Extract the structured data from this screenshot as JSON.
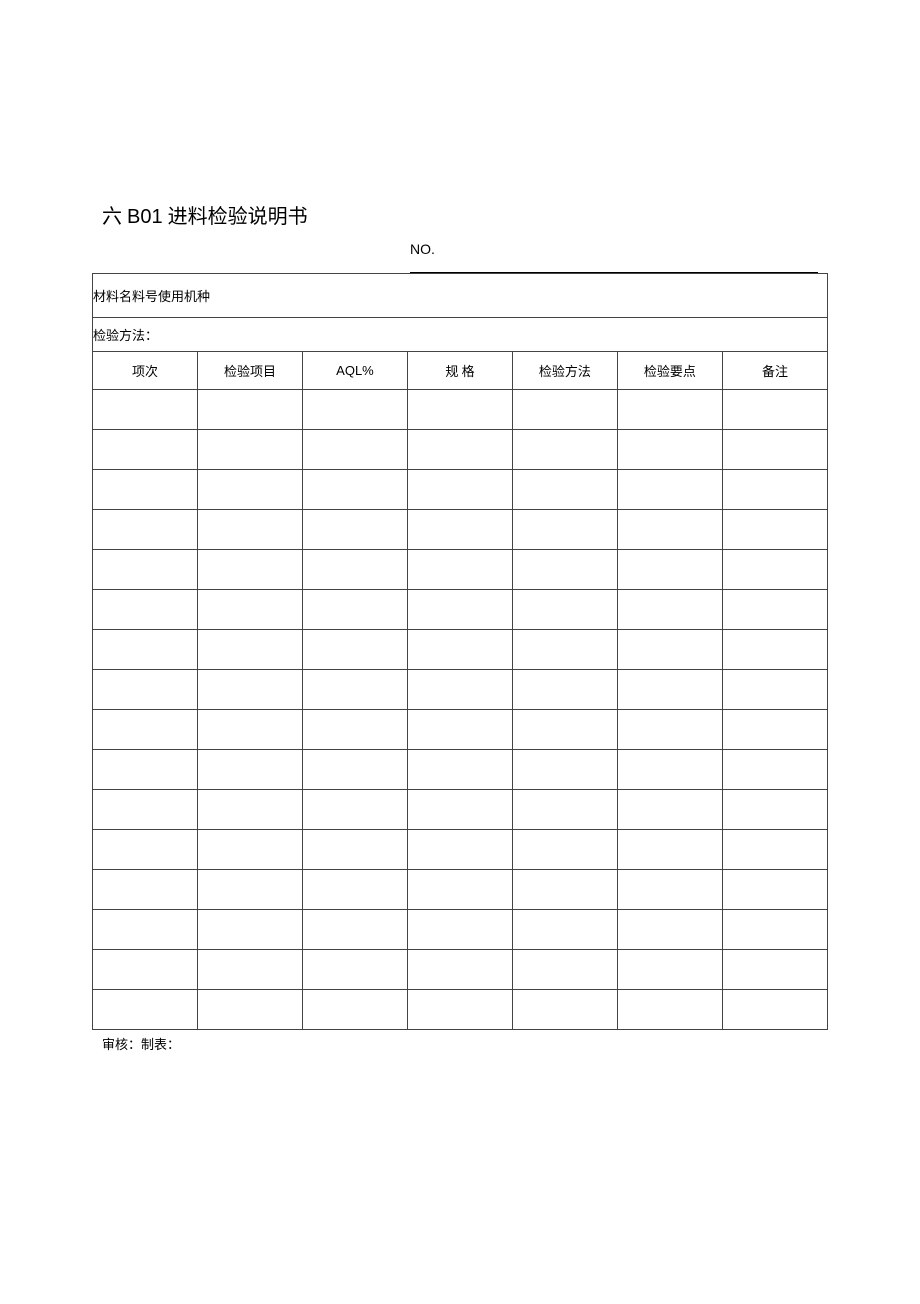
{
  "title_prefix": "六 ",
  "title_code": "B01",
  "title_rest": " 进料检验说明书",
  "no_label": "NO.",
  "row_material": "材料名料号使用机种",
  "row_method": "检验方法：",
  "headers": {
    "c1": "项次",
    "c2": "检验项目",
    "c3": "AQL%",
    "c4": "规  格",
    "c5": "检验方法",
    "c6": "检验要点",
    "c7": "备注"
  },
  "footer": "审核：制表："
}
